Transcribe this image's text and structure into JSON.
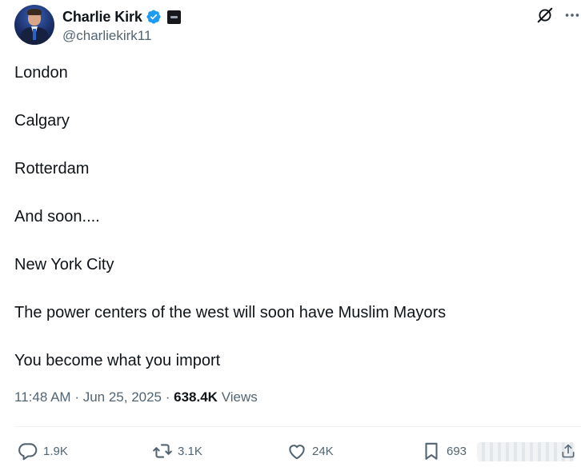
{
  "author": {
    "display_name": "Charlie Kirk",
    "handle": "@charliekirk11",
    "verified_badge_color": "#1d9bf0"
  },
  "tweet": {
    "lines": [
      "London",
      "Calgary",
      "Rotterdam",
      "And soon....",
      "New York City",
      "The power centers of the west will soon have Muslim Mayors",
      "You become what you import"
    ],
    "time": "11:48 AM",
    "date": "Jun 25, 2025",
    "views_count": "638.4K",
    "views_label": "Views"
  },
  "actions": {
    "replies": "1.9K",
    "reposts": "3.1K",
    "likes": "24K",
    "bookmarks": "693"
  },
  "icons": {
    "grok": "grok-icon",
    "more": "more-icon",
    "reply": "reply-icon",
    "repost": "repost-icon",
    "like": "heart-icon",
    "bookmark": "bookmark-icon",
    "share": "share-icon"
  },
  "colors": {
    "text": "#0f1419",
    "secondary": "#536471",
    "divider": "#eff3f4"
  }
}
